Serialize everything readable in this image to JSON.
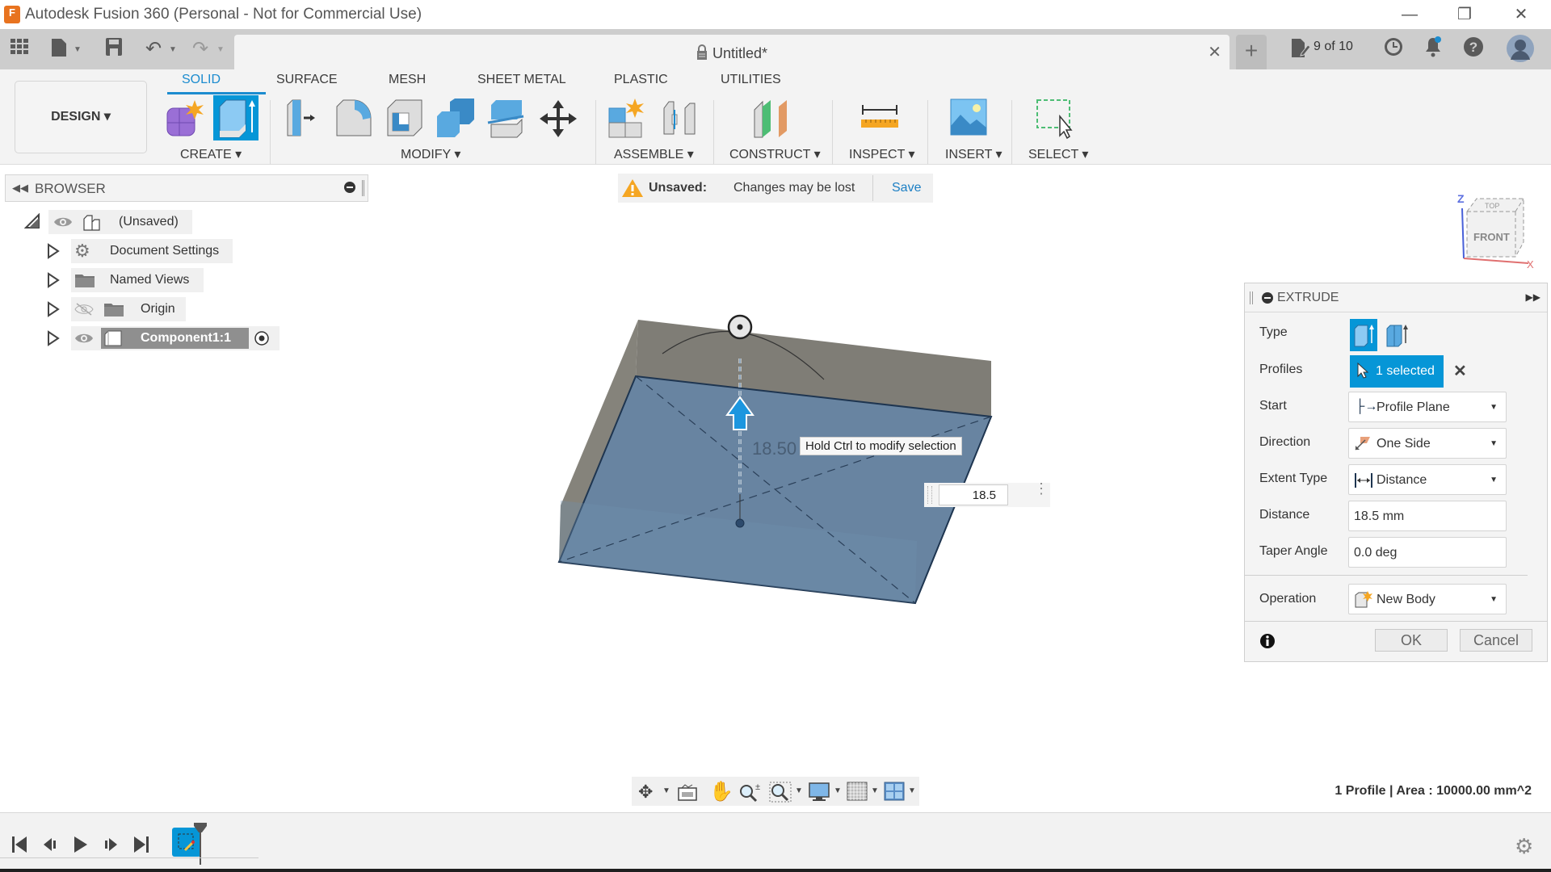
{
  "window": {
    "title": "Autodesk Fusion 360 (Personal - Not for Commercial Use)",
    "app_icon_letter": "F",
    "minimize": "—",
    "restore": "❐",
    "close": "✕"
  },
  "tabbar": {
    "document_title": "Untitled*",
    "close_label": "✕",
    "new_tab_label": "+",
    "version_label": "9 of 10"
  },
  "ribbon": {
    "workspace_label": "DESIGN ▾",
    "tabs": [
      {
        "label": "SOLID",
        "active": true
      },
      {
        "label": "SURFACE",
        "active": false
      },
      {
        "label": "MESH",
        "active": false
      },
      {
        "label": "SHEET METAL",
        "active": false
      },
      {
        "label": "PLASTIC",
        "active": false
      },
      {
        "label": "UTILITIES",
        "active": false
      }
    ],
    "groups": [
      {
        "label": "CREATE ▾"
      },
      {
        "label": "MODIFY ▾"
      },
      {
        "label": "ASSEMBLE ▾"
      },
      {
        "label": "CONSTRUCT ▾"
      },
      {
        "label": "INSPECT ▾"
      },
      {
        "label": "INSERT ▾"
      },
      {
        "label": "SELECT ▾"
      }
    ]
  },
  "browser": {
    "title": "BROWSER",
    "items": [
      {
        "label": "(Unsaved)"
      },
      {
        "label": "Document Settings"
      },
      {
        "label": "Named Views"
      },
      {
        "label": "Origin"
      },
      {
        "label": "Component1:1"
      }
    ]
  },
  "banner": {
    "status": "Unsaved:",
    "message": "Changes may be lost",
    "save_label": "Save"
  },
  "viewport": {
    "dimension_label": "18.50",
    "tooltip": "Hold Ctrl to modify selection",
    "distance_input": "18.5",
    "viewcube_front": "FRONT",
    "viewcube_top": "TOP",
    "axis_z": "Z",
    "axis_x": "X",
    "status": "1 Profile | Area : 10000.00 mm^2"
  },
  "extrude": {
    "title": "EXTRUDE",
    "rows": {
      "type_label": "Type",
      "profiles_label": "Profiles",
      "profiles_value": "1 selected",
      "start_label": "Start",
      "start_value": "Profile Plane",
      "direction_label": "Direction",
      "direction_value": "One Side",
      "extent_label": "Extent Type",
      "extent_value": "Distance",
      "distance_label": "Distance",
      "distance_value": "18.5 mm",
      "taper_label": "Taper Angle",
      "taper_value": "0.0 deg",
      "operation_label": "Operation",
      "operation_value": "New Body"
    },
    "ok_label": "OK",
    "cancel_label": "Cancel"
  },
  "colors": {
    "accent": "#0696d7",
    "warning": "#f5a623",
    "profile_fill": "#5b7a99",
    "body_gray": "#7f7d76"
  }
}
